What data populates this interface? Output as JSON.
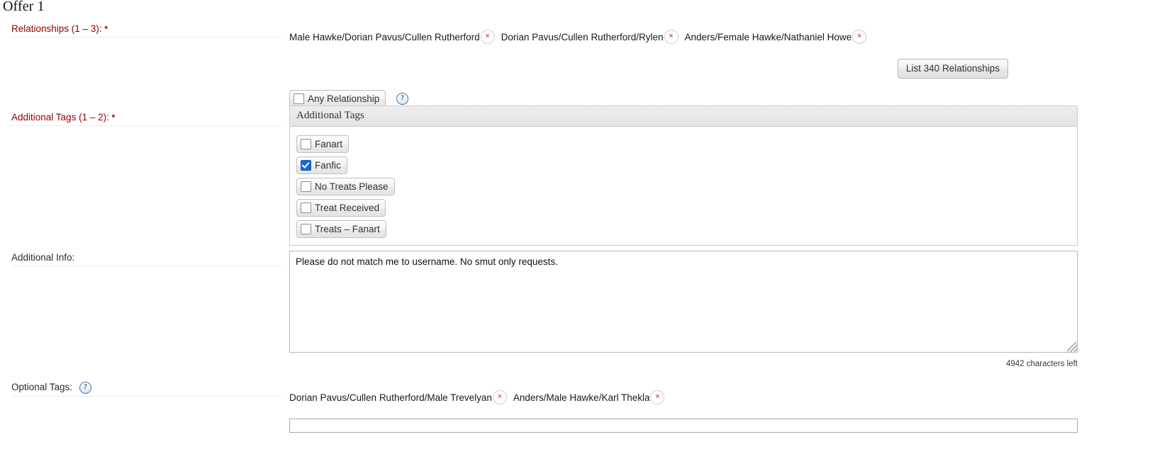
{
  "page": {
    "heading": "Offer 1"
  },
  "relationships": {
    "label": "Relationships (1 – 3):",
    "required_marker": "*",
    "tags": [
      "Male Hawke/Dorian Pavus/Cullen Rutherford",
      "Dorian Pavus/Cullen Rutherford/Rylen",
      "Anders/Female Hawke/Nathaniel Howe"
    ],
    "remove_icon": "×",
    "list_button_label": "List 340 Relationships",
    "any_relationship": {
      "label": "Any Relationship",
      "checked": false
    },
    "help_icon": "?"
  },
  "additional_tags": {
    "label": "Additional Tags (1 – 2):",
    "required_marker": "*",
    "panel_title": "Additional Tags",
    "options": [
      {
        "label": "Fanart",
        "checked": false
      },
      {
        "label": "Fanfic",
        "checked": true
      },
      {
        "label": "No Treats Please",
        "checked": false
      },
      {
        "label": "Treat Received",
        "checked": false
      },
      {
        "label": "Treats – Fanart",
        "checked": false
      }
    ]
  },
  "additional_info": {
    "label": "Additional Info:",
    "value": "Please do not match me to username. No smut only requests.",
    "characters_left": "4942 characters left"
  },
  "optional_tags": {
    "label": "Optional Tags:",
    "help_icon": "?",
    "tags": [
      "Dorian Pavus/Cullen Rutherford/Male Trevelyan",
      "Anders/Male Hawke/Karl Thekla"
    ],
    "remove_icon": "×",
    "input_value": "",
    "input_placeholder": ""
  },
  "colors": {
    "required_label": "#900000",
    "plain_label": "#2b2b2b",
    "remove_x": "#bb2222",
    "checked_box": "#1367d6"
  }
}
